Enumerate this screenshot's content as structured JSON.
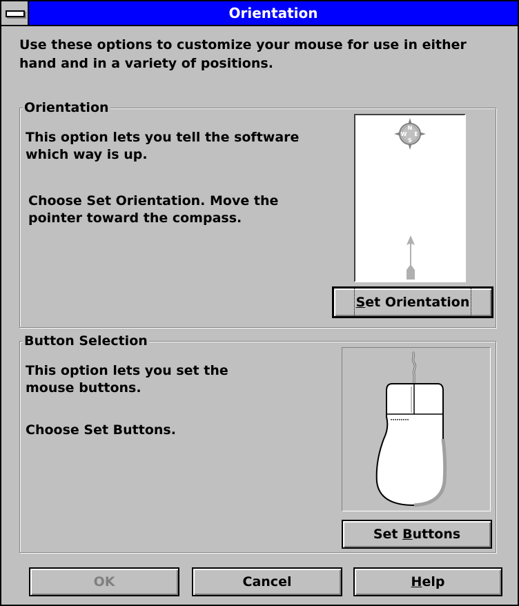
{
  "window": {
    "title": "Orientation"
  },
  "intro_text": "Use these options to customize your mouse for use in either hand and in a variety of positions.",
  "orientation_group": {
    "label": "Orientation",
    "line1": "This option lets you tell the software which way is up.",
    "line2": "Choose Set Orientation.  Move the pointer toward the compass.",
    "compass_letters": [
      "N",
      "W",
      "E",
      "S"
    ],
    "button": {
      "prefix": "",
      "mnemonic": "S",
      "suffix": "et Orientation"
    }
  },
  "button_group": {
    "label": "Button Selection",
    "line1": "This option lets you set the mouse buttons.",
    "line2": "Choose Set Buttons.",
    "button": {
      "prefix": "Set ",
      "mnemonic": "B",
      "suffix": "uttons"
    }
  },
  "footer": {
    "ok": "OK",
    "cancel": "Cancel",
    "help": {
      "mnemonic": "H",
      "suffix": "elp"
    }
  },
  "colors": {
    "titlebar": "#0000ff",
    "face": "#c0c0c0"
  }
}
